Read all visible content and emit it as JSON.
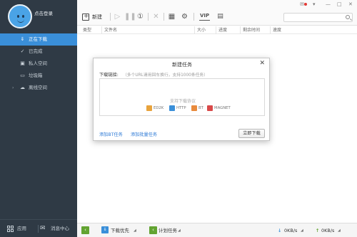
{
  "user": {
    "login_label": "点击登录"
  },
  "sidebar": {
    "items": [
      {
        "label": "正在下载",
        "icon": "download-icon",
        "active": true
      },
      {
        "label": "已完成",
        "icon": "check-circle-icon"
      },
      {
        "label": "私人空间",
        "icon": "lock-icon"
      },
      {
        "label": "垃圾箱",
        "icon": "trash-icon"
      },
      {
        "label": "离线空间",
        "icon": "cloud-icon"
      }
    ],
    "apps_label": "应用",
    "messages_label": "消息中心"
  },
  "toolbar": {
    "new_label": "新建",
    "vip_label": "VIP"
  },
  "columns": [
    "类型",
    "文件名",
    "大小",
    "进度",
    "剩余时间",
    "速度"
  ],
  "statusbar": {
    "priority_label": "下载优先",
    "schedule_label": "计划任务",
    "download_speed": "0KB/s",
    "upload_speed": "0KB/s"
  },
  "dialog": {
    "title": "新建任务",
    "link_label": "下载链接:",
    "hint": "（多个URL请用回车换行，支持1000条任务）",
    "supports_label": "支持下载协议",
    "protocols": [
      {
        "name": "ED2K",
        "color": "#e8a33c"
      },
      {
        "name": "HTTP",
        "color": "#3a8fd9"
      },
      {
        "name": "BT",
        "color": "#e88a3c"
      },
      {
        "name": "MAGNET",
        "color": "#d94a4a"
      }
    ],
    "add_bt_label": "添加BT任务",
    "add_batch_label": "添加批量任务",
    "download_now_label": "立即下载"
  },
  "colors": {
    "accent": "#3a8fd9",
    "sidebar_bg": "#2f3a45",
    "link": "#2d7ad6"
  }
}
